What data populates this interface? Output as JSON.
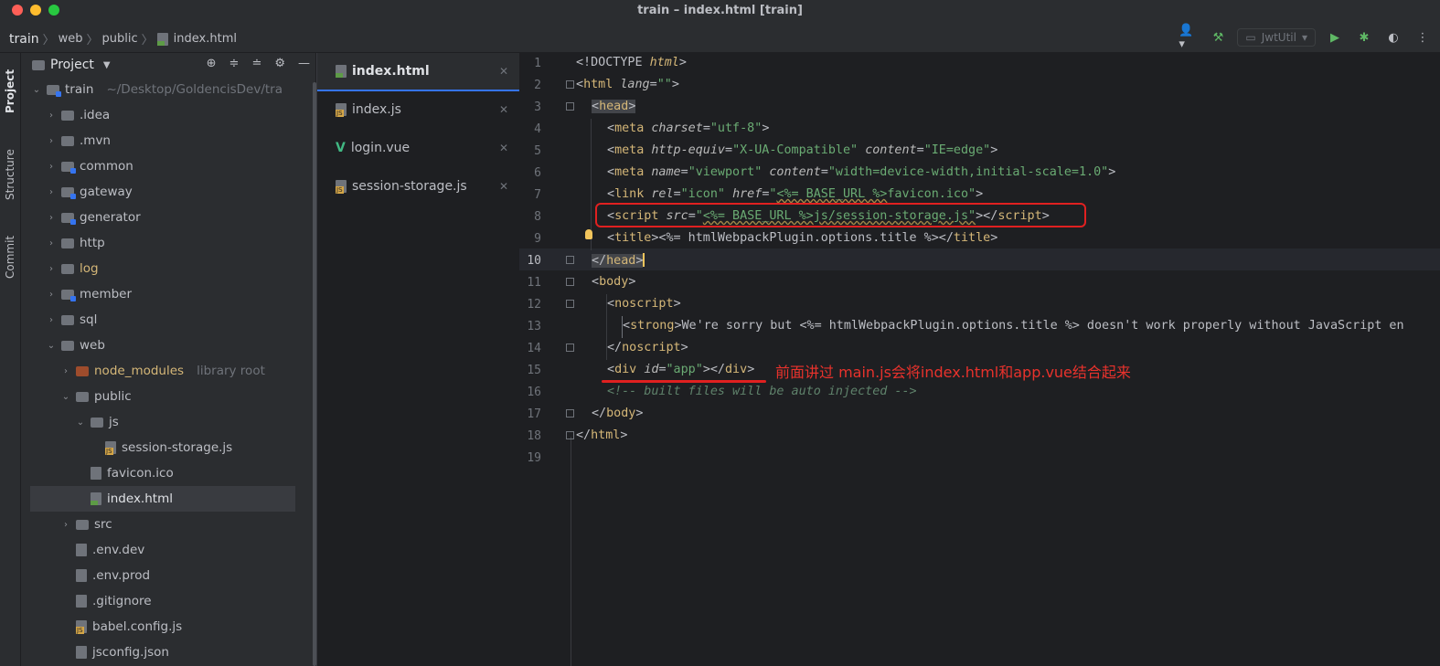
{
  "window": {
    "title": "train – index.html [train]"
  },
  "breadcrumbs": [
    "train",
    "web",
    "public",
    "index.html"
  ],
  "toolbar": {
    "run_config": "JwtUtil"
  },
  "stripe": {
    "project": "Project",
    "structure": "Structure",
    "commit": "Commit"
  },
  "project_panel": {
    "title": "Project",
    "root": {
      "name": "train",
      "path": "~/Desktop/GoldencisDev/tra"
    },
    "items": [
      {
        "name": ".idea"
      },
      {
        "name": ".mvn"
      },
      {
        "name": "common"
      },
      {
        "name": "gateway"
      },
      {
        "name": "generator"
      },
      {
        "name": "http"
      },
      {
        "name": "log"
      },
      {
        "name": "member"
      },
      {
        "name": "sql"
      },
      {
        "name": "web"
      },
      {
        "name": "node_modules",
        "note": "library root"
      },
      {
        "name": "public"
      },
      {
        "name": "js"
      },
      {
        "name": "session-storage.js"
      },
      {
        "name": "favicon.ico"
      },
      {
        "name": "index.html"
      },
      {
        "name": "src"
      },
      {
        "name": ".env.dev"
      },
      {
        "name": ".env.prod"
      },
      {
        "name": ".gitignore"
      },
      {
        "name": "babel.config.js"
      },
      {
        "name": "jsconfig.json"
      }
    ]
  },
  "tabs": [
    {
      "label": "index.html"
    },
    {
      "label": "index.js"
    },
    {
      "label": "login.vue"
    },
    {
      "label": "session-storage.js"
    }
  ],
  "editor": {
    "line_numbers": [
      "1",
      "2",
      "3",
      "4",
      "5",
      "6",
      "7",
      "8",
      "9",
      "10",
      "11",
      "12",
      "13",
      "14",
      "15",
      "16",
      "17",
      "18",
      "19"
    ],
    "current_line": 10,
    "annotation": "前面讲过 main.js会将index.html和app.vue结合起来",
    "lines": {
      "l1": [
        "<!DOCTYPE ",
        "html",
        ">"
      ],
      "l2": [
        "<",
        "html",
        " ",
        "lang",
        "=",
        "\"\"",
        ">"
      ],
      "l3": [
        "<",
        "head",
        ">"
      ],
      "l4": [
        "<",
        "meta",
        " ",
        "charset",
        "=",
        "\"utf-8\"",
        ">"
      ],
      "l5": [
        "<",
        "meta",
        " ",
        "http-equiv",
        "=",
        "\"X-UA-Compatible\"",
        " ",
        "content",
        "=",
        "\"IE=edge\"",
        ">"
      ],
      "l6": [
        "<",
        "meta",
        " ",
        "name",
        "=",
        "\"viewport\"",
        " ",
        "content",
        "=",
        "\"width=device-width,initial-scale=1.0\"",
        ">"
      ],
      "l7": [
        "<",
        "link",
        " ",
        "rel",
        "=",
        "\"icon\"",
        " ",
        "href",
        "=",
        "\"",
        "<%= BASE_URL %>",
        "favicon.ico\"",
        ">"
      ],
      "l8": [
        "<",
        "script",
        " ",
        "src",
        "=",
        "\"",
        "<%= BASE_URL %>",
        "js/session-storage.js\"",
        "></",
        "script",
        ">"
      ],
      "l9": [
        "<",
        "title",
        ">",
        "<%= htmlWebpackPlugin.options.title %>",
        "</",
        "title",
        ">"
      ],
      "l10": [
        "</",
        "head",
        ">"
      ],
      "l11": [
        "<",
        "body",
        ">"
      ],
      "l12": [
        "<",
        "noscript",
        ">"
      ],
      "l13": [
        "<",
        "strong",
        ">",
        "We're sorry but <%= htmlWebpackPlugin.options.title %> doesn't work properly without JavaScript en"
      ],
      "l14": [
        "</",
        "noscript",
        ">"
      ],
      "l15": [
        "<",
        "div",
        " ",
        "id",
        "=",
        "\"app\"",
        "></",
        "div",
        ">"
      ],
      "l16": [
        "<!-- built files will be auto injected -->"
      ],
      "l17": [
        "</",
        "body",
        ">"
      ],
      "l18": [
        "</",
        "html",
        ">"
      ]
    }
  },
  "colors": {
    "accent": "#3574f0",
    "annotation_red": "#e02020",
    "tag": "#d5b778",
    "string": "#6aab73"
  }
}
